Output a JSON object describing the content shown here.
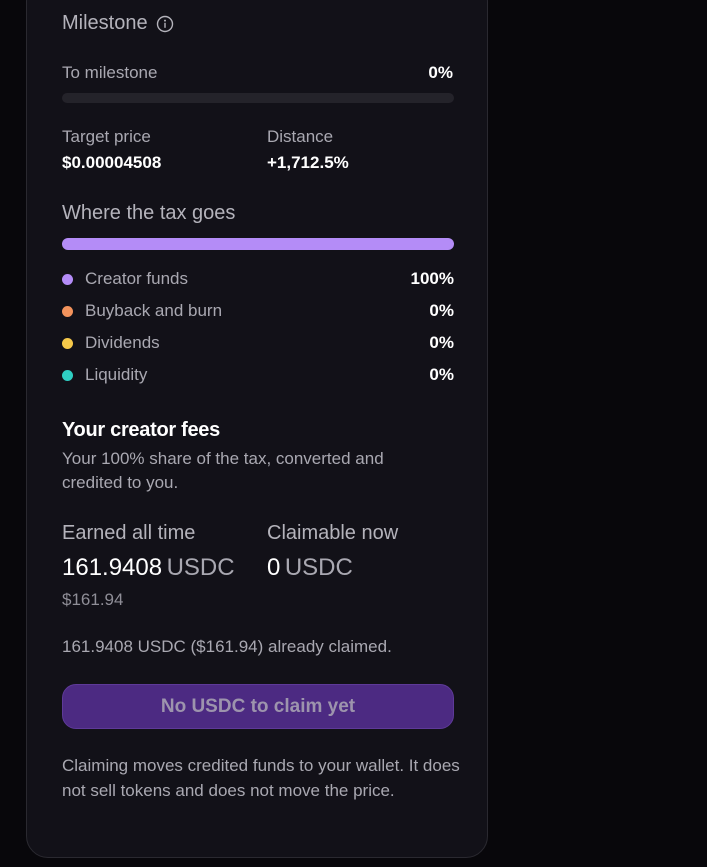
{
  "milestone": {
    "title": "Milestone",
    "to_milestone_label": "To milestone",
    "to_milestone_value": "0%",
    "progress_fraction": 0,
    "target_price_label": "Target price",
    "target_price_value": "$0.00004508",
    "distance_label": "Distance",
    "distance_value": "+1,712.5%"
  },
  "tax": {
    "title": "Where the tax goes",
    "items": [
      {
        "label": "Creator funds",
        "pct": "100%",
        "fraction": 1.0,
        "color": "#b48cf7"
      },
      {
        "label": "Buyback and burn",
        "pct": "0%",
        "fraction": 0,
        "color": "#f3935c"
      },
      {
        "label": "Dividends",
        "pct": "0%",
        "fraction": 0,
        "color": "#f6c94a"
      },
      {
        "label": "Liquidity",
        "pct": "0%",
        "fraction": 0,
        "color": "#2fcfc3"
      }
    ]
  },
  "fees": {
    "title": "Your creator fees",
    "description": "Your 100% share of the tax, converted and credited to you.",
    "earned_label": "Earned all time",
    "earned_value": "161.9408",
    "earned_unit": "USDC",
    "earned_usd": "$161.94",
    "claimable_label": "Claimable now",
    "claimable_value": "0",
    "claimable_unit": "USDC",
    "claimed_note": "161.9408 USDC ($161.94) already claimed.",
    "claim_button_label": "No USDC to claim yet",
    "footer_note": "Claiming moves credited funds to your wallet. It does not sell tokens and does not move the price."
  },
  "colors": {
    "accent": "#b48cf7",
    "card_bg": "#121118",
    "page_bg": "#08070b",
    "button_bg": "#4c2a82"
  }
}
